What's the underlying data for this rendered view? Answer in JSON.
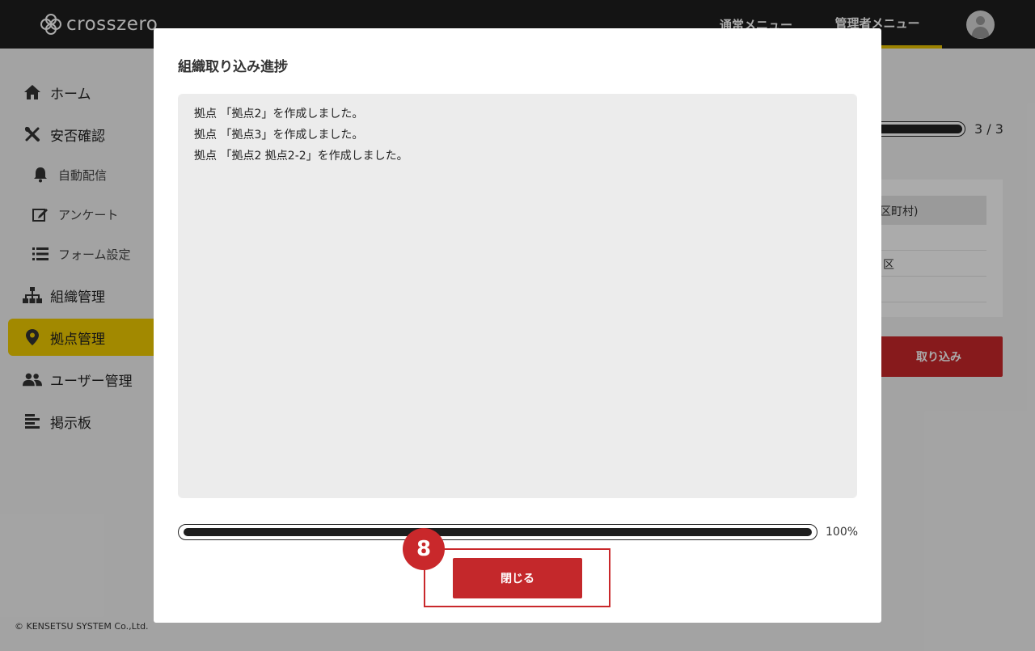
{
  "header": {
    "logo_text": "crosszero",
    "nav_normal": "通常メニュー",
    "nav_admin": "管理者メニュー",
    "accent_color": "#e8c200"
  },
  "sidebar": {
    "items": [
      {
        "label": "ホーム",
        "icon": "home-icon"
      },
      {
        "label": "安否確認",
        "icon": "tools-icon"
      },
      {
        "label": "自動配信",
        "icon": "bell-icon"
      },
      {
        "label": "アンケート",
        "icon": "edit-icon"
      },
      {
        "label": "フォーム設定",
        "icon": "list-icon"
      },
      {
        "label": "組織管理",
        "icon": "org-chart-icon"
      },
      {
        "label": "拠点管理",
        "icon": "map-pin-icon"
      },
      {
        "label": "ユーザー管理",
        "icon": "users-icon"
      },
      {
        "label": "掲示板",
        "icon": "board-icon"
      }
    ],
    "active_index": 6
  },
  "footer": {
    "copyright": "© KENSETSU SYSTEM Co.,Ltd."
  },
  "background": {
    "count": "3 / 3",
    "table_header": "区町村)",
    "table_cell": "区",
    "import_button": "取り込み"
  },
  "modal": {
    "title": "組織取り込み進捗",
    "log_lines": [
      "拠点 「拠点2」を作成しました。",
      "拠点 「拠点3」を作成しました。",
      "拠点 「拠点2 拠点2-2」を作成しました。"
    ],
    "progress_percent": 100,
    "progress_label": "100%",
    "close_button": "閉じる",
    "step_number": "8",
    "button_color": "#c4282b"
  }
}
